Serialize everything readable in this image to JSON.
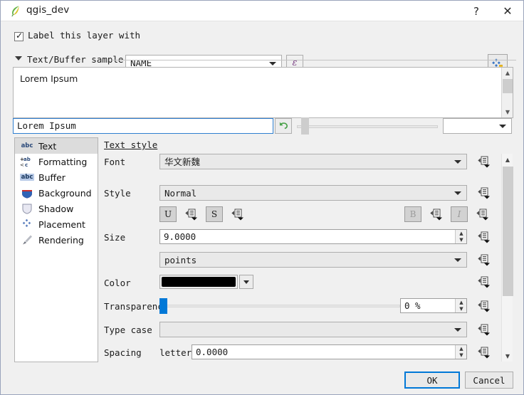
{
  "window": {
    "title": "qgis_dev",
    "icon": "qgis-leaf-icon",
    "help_label": "?",
    "close_label": "✕"
  },
  "label_row": {
    "checkbox_checked": true,
    "checkbox_tick": "✓",
    "checkbox_label": "Label this layer with",
    "field_value": "NAME",
    "expression_button": "ε",
    "data_defined_button": "data-defined-override-icon"
  },
  "group": {
    "expanded": true,
    "title": "Text/Buffer sample"
  },
  "preview": {
    "sample_text": "Lorem Ipsum",
    "input_value": "Lorem Ipsum",
    "revert_icon": "revert-arrow-icon",
    "zoom_value": ""
  },
  "sidebar": {
    "items": [
      {
        "label": "Text",
        "icon": "abc-text-icon",
        "selected": true
      },
      {
        "label": "Formatting",
        "icon": "formatting-icon",
        "selected": false
      },
      {
        "label": "Buffer",
        "icon": "abc-buffer-icon",
        "selected": false
      },
      {
        "label": "Background",
        "icon": "background-shape-icon",
        "selected": false
      },
      {
        "label": "Shadow",
        "icon": "shadow-shape-icon",
        "selected": false
      },
      {
        "label": "Placement",
        "icon": "placement-icon",
        "selected": false
      },
      {
        "label": "Rendering",
        "icon": "rendering-brush-icon",
        "selected": false
      }
    ]
  },
  "panel": {
    "title": "Text style",
    "font": {
      "label": "Font",
      "value": "华文新魏"
    },
    "style": {
      "label": "Style",
      "value": "Normal"
    },
    "format_buttons": {
      "underline": "U",
      "strikethrough": "S",
      "bold": "B",
      "italic": "I"
    },
    "size": {
      "label": "Size",
      "value": "9.0000",
      "units": "points"
    },
    "color": {
      "label": "Color",
      "value": "#000000"
    },
    "transparency": {
      "label": "Transparency",
      "value": "0 %",
      "slider_percent": 0
    },
    "type_case": {
      "label": "Type case",
      "value": ""
    },
    "spacing": {
      "label": "Spacing",
      "sub_label": "letter",
      "value": "0.0000"
    },
    "spin_up": "▲",
    "spin_down": "▼"
  },
  "footer": {
    "ok_label": "OK",
    "cancel_label": "Cancel"
  }
}
